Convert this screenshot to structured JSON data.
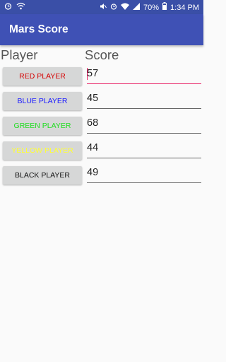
{
  "status_bar": {
    "battery": "70%",
    "time": "1:34 PM"
  },
  "app_bar": {
    "title": "Mars Score"
  },
  "headers": {
    "player": "Player",
    "score": "Score"
  },
  "players": [
    {
      "label": "RED PLAYER",
      "color": "#d50000",
      "score": "57",
      "focused": true
    },
    {
      "label": "BLUE PLAYER",
      "color": "#1a1aff",
      "score": "45",
      "focused": false
    },
    {
      "label": "GREEN PLAYER",
      "color": "#22dd22",
      "score": "68",
      "focused": false
    },
    {
      "label": "YELLOW PLAYER",
      "color": "#ffff33",
      "score": "44",
      "focused": false
    },
    {
      "label": "BLACK PLAYER",
      "color": "#111111",
      "score": "49",
      "focused": false
    }
  ],
  "colors": {
    "primary": "#3f51b5",
    "primary_dark": "#3a4fa7",
    "accent": "#e91e63"
  }
}
